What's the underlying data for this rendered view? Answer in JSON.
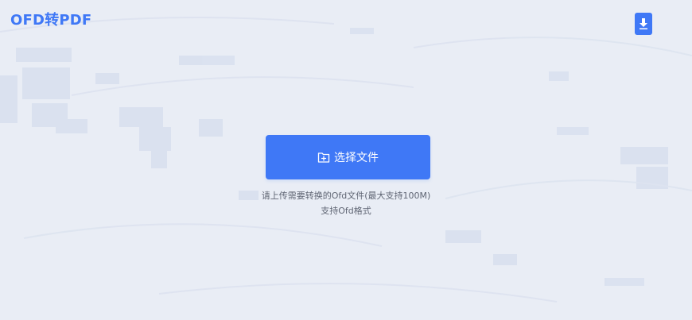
{
  "header": {
    "title": "OFD转PDF",
    "download_icon": "download-icon"
  },
  "upload": {
    "button_label": "选择文件",
    "button_icon": "folder-add-icon",
    "hint_line1": "请上传需要转换的Ofd文件(最大支持100M)",
    "hint_line2": "支持Ofd格式"
  },
  "colors": {
    "accent": "#3f78f6",
    "background": "#e9edf5",
    "hint_text": "#5f6573"
  }
}
